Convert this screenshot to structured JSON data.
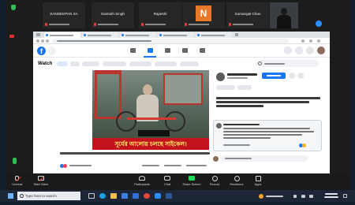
{
  "zoom": {
    "participants": [
      {
        "name": "SANDEEPAN SA"
      },
      {
        "name": "Santosh Singh"
      },
      {
        "name": "Rajarshi"
      },
      {
        "initial": "N"
      },
      {
        "name": "Sumangal Chau"
      }
    ],
    "toolbar": {
      "unmute": "Unmute",
      "start_video": "Start Video",
      "participants": "Participants",
      "chat": "Chat",
      "share_screen": "Share Screen",
      "record": "Record",
      "reactions": "Reactions",
      "apps": "Apps"
    }
  },
  "facebook": {
    "logo": "f",
    "section_title": "Watch",
    "video_banner": "সূর্যের আলোয় চলছে সাইকেল।"
  },
  "taskbar": {
    "search_placeholder": "Type here to search"
  },
  "colors": {
    "facebook_blue": "#1877f2",
    "zoom_tile_orange": "#e8782a",
    "banner_red": "#c3121b",
    "banner_text": "#fff36b",
    "share_screen_green": "#23d959"
  }
}
